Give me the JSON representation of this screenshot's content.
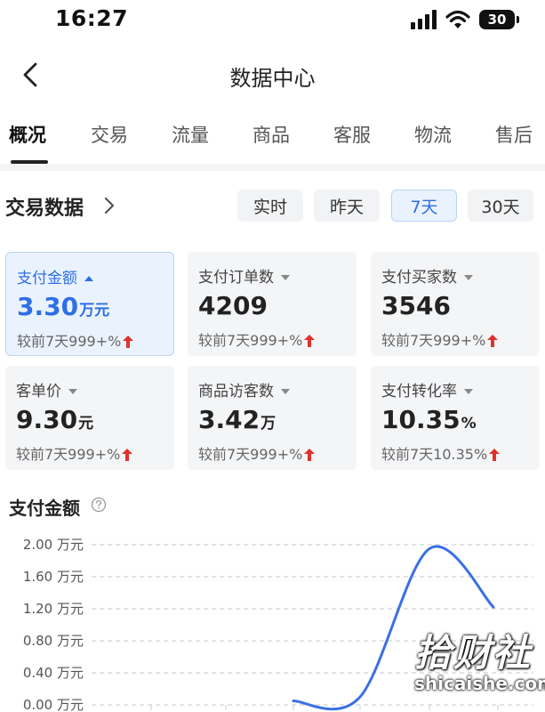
{
  "status_bar": {
    "time": "16:27",
    "battery": "30",
    "icons": [
      "signal-icon",
      "wifi-icon",
      "battery-icon"
    ]
  },
  "nav": {
    "title": "数据中心",
    "back_icon": "chevron-left-icon"
  },
  "tabs": [
    "概况",
    "交易",
    "流量",
    "商品",
    "客服",
    "物流",
    "售后"
  ],
  "active_tab": "概况",
  "section": {
    "title": "交易数据",
    "periods": [
      "实时",
      "昨天",
      "7天",
      "30天"
    ],
    "active_period": "7天"
  },
  "metrics": [
    {
      "label": "支付金额",
      "value": "3.30",
      "unit": "万元",
      "compare": "较前7天999+%",
      "active": true
    },
    {
      "label": "支付订单数",
      "value": "4209",
      "unit": "",
      "compare": "较前7天999+%",
      "active": false
    },
    {
      "label": "支付买家数",
      "value": "3546",
      "unit": "",
      "compare": "较前7天999+%",
      "active": false
    },
    {
      "label": "客单价",
      "value": "9.30",
      "unit": "元",
      "compare": "较前7天999+%",
      "active": false
    },
    {
      "label": "商品访客数",
      "value": "3.42",
      "unit": "万",
      "compare": "较前7天999+%",
      "active": false
    },
    {
      "label": "支付转化率",
      "value": "10.35",
      "unit": "%",
      "compare": "较前7天10.35%",
      "active": false
    }
  ],
  "colors": {
    "accent": "#2f6ee6",
    "line": "#3a70e3",
    "up_arrow": "#e0322b",
    "card_bg": "#f4f5f7",
    "active_bg": "#eaf3fd"
  },
  "chart_title": "支付金额",
  "chart_data": {
    "type": "line",
    "title": "",
    "xlabel": "",
    "ylabel": "",
    "y_tick_labels": [
      "2.00 万元",
      "1.60 万元",
      "1.20 万元",
      "0.80 万元",
      "0.40 万元",
      "0.00 万元"
    ],
    "y_ticks": [
      2.0,
      1.6,
      1.2,
      0.8,
      0.4,
      0.0
    ],
    "ylim": [
      0,
      2.0
    ],
    "x": [
      1,
      2,
      3,
      4,
      5,
      6,
      7
    ],
    "values": [
      0.0,
      0.0,
      0.0,
      0.05,
      0.1,
      1.95,
      1.22
    ],
    "grid": true,
    "legend": "none"
  },
  "watermark": {
    "main": "拾财社",
    "sub": "shicaishe.com"
  }
}
